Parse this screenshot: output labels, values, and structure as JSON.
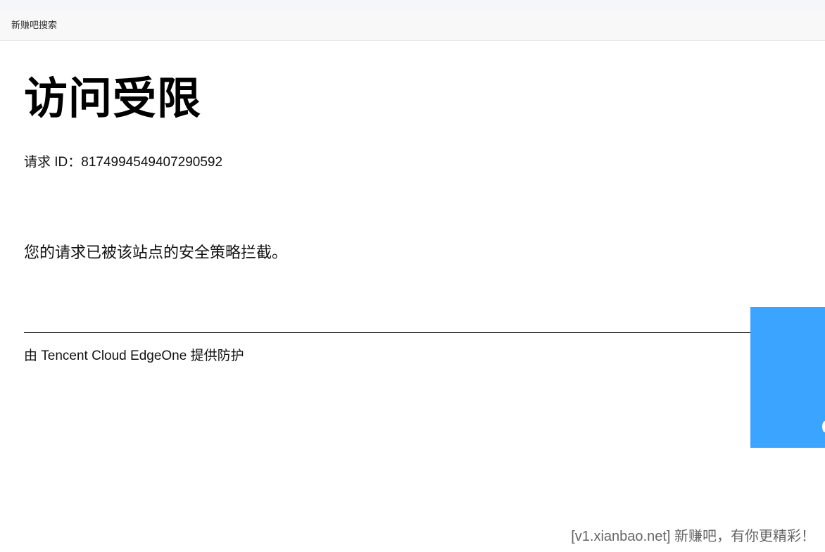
{
  "top_bar": {
    "title": "新赚吧搜索"
  },
  "main": {
    "title": "访问受限",
    "request_id": "请求 ID：8174994549407290592",
    "message": "您的请求已被该站点的安全策略拦截。",
    "powered_by": "由 Tencent Cloud EdgeOne 提供防护"
  },
  "side_panel": {
    "color": "#3ba4ff"
  },
  "footer": {
    "watermark": "[v1.xianbao.net] 新赚吧，有你更精彩！"
  }
}
